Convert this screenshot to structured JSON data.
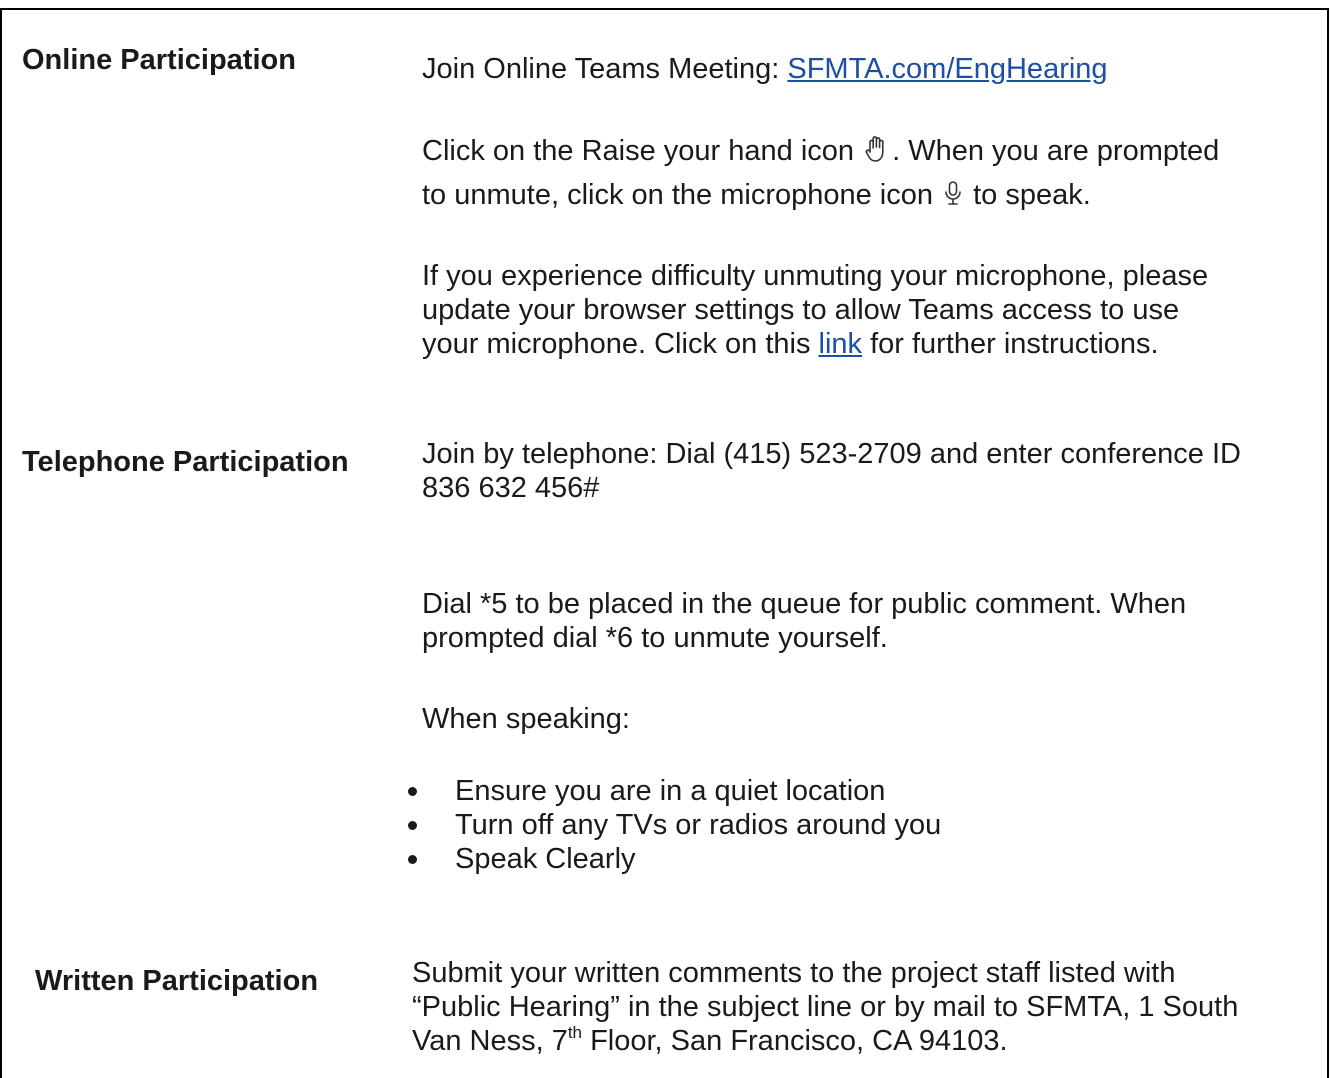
{
  "online": {
    "label": "Online Participation",
    "join_prefix": "Join Online Teams Meeting: ",
    "join_link": "SFMTA.com/EngHearing",
    "raise_part1": "Click on the Raise your hand icon ",
    "raise_part2": ". When you are prompted",
    "unmute_part1": "to unmute, click on the microphone icon ",
    "unmute_part2": " to speak.",
    "difficulty_line1": "If you experience difficulty unmuting your microphone, please",
    "difficulty_line2": "update your browser settings to allow Teams access to use",
    "difficulty_line3_part1": "your microphone.  Click on this ",
    "difficulty_link": "link",
    "difficulty_line3_part2": " for further instructions.",
    "hand_icon": "raise-hand-icon",
    "mic_icon": "microphone-icon"
  },
  "telephone": {
    "label": "Telephone Participation",
    "join_line1": "Join by telephone: Dial (415) 523-2709 and enter conference ID",
    "join_line2": "836 632 456#",
    "queue_line1": "Dial *5 to be placed in the queue for public comment. When",
    "queue_line2": "prompted dial *6 to unmute yourself.",
    "speaking_heading": "When speaking:",
    "tips": [
      "Ensure you are in a quiet location",
      "Turn off any TVs or radios around you",
      "Speak Clearly"
    ]
  },
  "written": {
    "label": "Written Participation",
    "line1": "Submit your written comments to the project staff listed with",
    "line2": "“Public Hearing” in the subject line or by mail to SFMTA, 1 South",
    "line3_part1": "Van Ness, 7",
    "line3_sup": "th",
    "line3_part2": " Floor, San Francisco, CA 94103."
  }
}
